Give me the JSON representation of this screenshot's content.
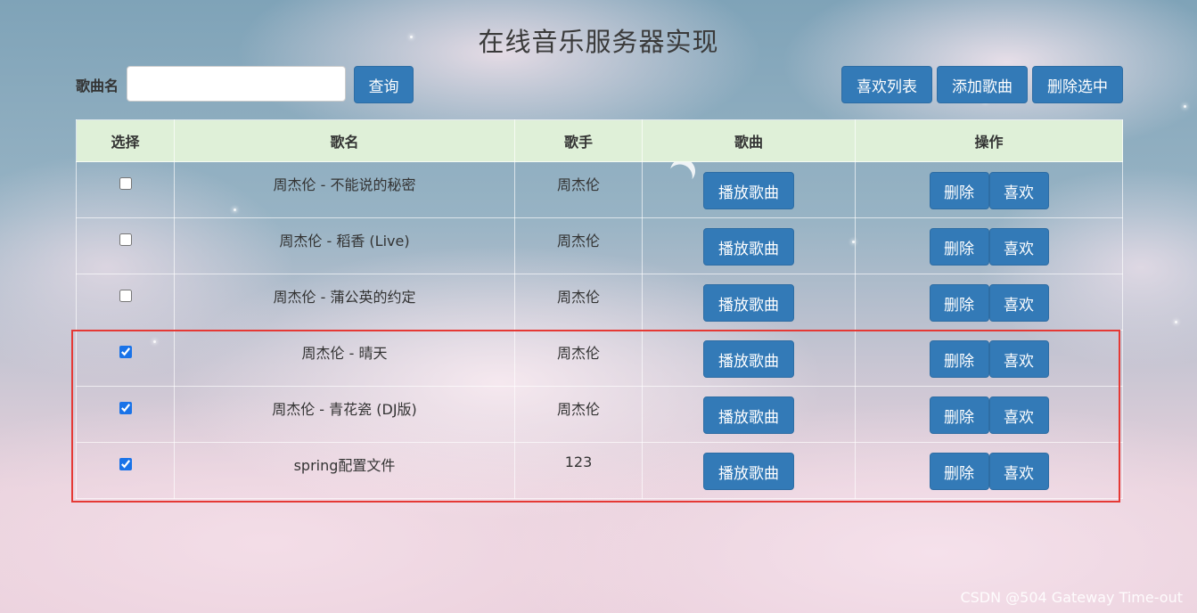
{
  "page": {
    "title": "在线音乐服务器实现",
    "watermark": "CSDN @504 Gateway Time-out"
  },
  "search": {
    "label": "歌曲名",
    "value": "",
    "placeholder": "",
    "button_label": "查询"
  },
  "toolbar": {
    "favorites_label": "喜欢列表",
    "add_label": "添加歌曲",
    "delete_selected_label": "删除选中"
  },
  "table": {
    "headers": [
      "选择",
      "歌名",
      "歌手",
      "歌曲",
      "操作"
    ],
    "play_label": "播放歌曲",
    "delete_label": "删除",
    "like_label": "喜欢",
    "rows": [
      {
        "checked": false,
        "title": "周杰伦 - 不能说的秘密",
        "singer": "周杰伦"
      },
      {
        "checked": false,
        "title": "周杰伦 - 稻香 (Live)",
        "singer": "周杰伦"
      },
      {
        "checked": false,
        "title": "周杰伦 - 蒲公英的约定",
        "singer": "周杰伦"
      },
      {
        "checked": true,
        "title": "周杰伦 - 晴天",
        "singer": "周杰伦"
      },
      {
        "checked": true,
        "title": "周杰伦 - 青花瓷 (DJ版)",
        "singer": "周杰伦"
      },
      {
        "checked": true,
        "title": "spring配置文件",
        "singer": "123"
      }
    ]
  },
  "colors": {
    "button": "#337ab7",
    "header_bg": "#dff0d8",
    "highlight_border": "#e53935"
  }
}
